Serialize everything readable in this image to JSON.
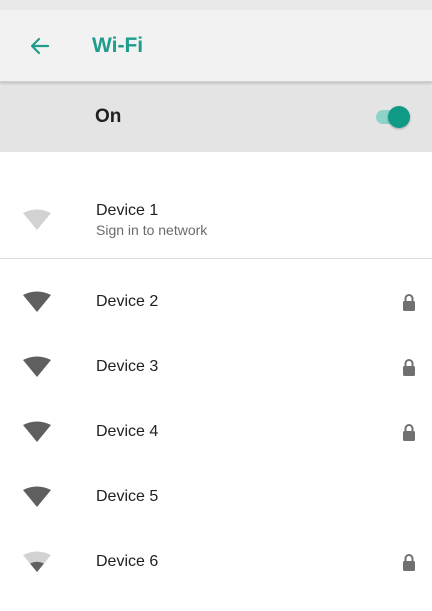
{
  "header": {
    "title": "Wi-Fi",
    "back_icon": "arrow-back-icon"
  },
  "master_switch": {
    "label": "On",
    "checked": true
  },
  "colors": {
    "accent": "#1f9c8c",
    "switch_thumb": "#0f9a86",
    "switch_track": "#8fd3c8"
  },
  "networks": [
    {
      "name": "Device 1",
      "status": "Sign in to network",
      "secured": false,
      "signal_icon": "wifi-signal-icon"
    },
    {
      "name": "Device 2",
      "secured": true,
      "signal_icon": "wifi-signal-icon",
      "lock_icon": "lock-icon"
    },
    {
      "name": "Device 3",
      "secured": true,
      "signal_icon": "wifi-signal-icon",
      "lock_icon": "lock-icon"
    },
    {
      "name": "Device 4",
      "secured": true,
      "signal_icon": "wifi-signal-icon",
      "lock_icon": "lock-icon"
    },
    {
      "name": "Device 5",
      "secured": false,
      "signal_icon": "wifi-signal-icon"
    },
    {
      "name": "Device 6",
      "secured": true,
      "signal_icon": "wifi-signal-icon",
      "lock_icon": "lock-icon"
    }
  ]
}
